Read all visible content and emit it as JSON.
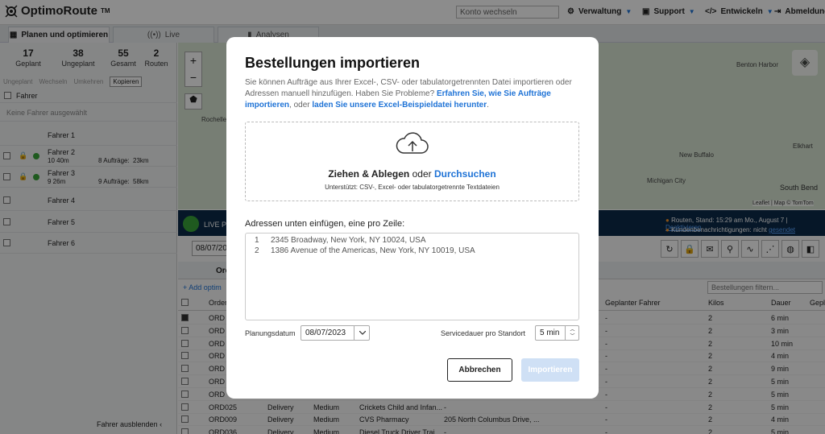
{
  "app": {
    "brand": "OptimoRoute",
    "brand_tm": "TM"
  },
  "topbar": {
    "account_switch_placeholder": "Konto wechseln",
    "nav": [
      "Verwaltung",
      "Support",
      "Entwickeln",
      "Abmeldung"
    ]
  },
  "tabs": [
    "Planen und optimieren",
    "Live",
    "Analysen"
  ],
  "stats": [
    {
      "value": "17",
      "label": "Geplant"
    },
    {
      "value": "38",
      "label": "Ungeplant"
    },
    {
      "value": "55",
      "label": "Gesamt"
    },
    {
      "value": "2",
      "label": "Routen"
    }
  ],
  "actions": {
    "unplan": "Ungeplant",
    "switch": "Wechseln",
    "redirect": "Umkehren",
    "copy": "Kopieren"
  },
  "drivers": {
    "header": "Fahrer",
    "none_selected": "Keine Fahrer ausgewählt",
    "list": [
      {
        "name": "Fahrer 1",
        "time": "",
        "orders": "",
        "dist": ""
      },
      {
        "name": "Fahrer 2",
        "time": "10 40m",
        "orders": "8 Aufträge:",
        "dist": "23km"
      },
      {
        "name": "Fahrer 3",
        "time": "9 26m",
        "orders": "9 Aufträge:",
        "dist": "58km"
      },
      {
        "name": "Fahrer 4",
        "time": "",
        "orders": "",
        "dist": ""
      },
      {
        "name": "Fahrer 5",
        "time": "",
        "orders": "",
        "dist": ""
      },
      {
        "name": "Fahrer 6",
        "time": "",
        "orders": "",
        "dist": ""
      }
    ],
    "hide": "Fahrer ausblenden"
  },
  "map": {
    "places": [
      "Benton Harbor",
      "Rochelle",
      "South Bend",
      "New Buffalo",
      "Michigan City",
      "Elkhart"
    ],
    "attribution": "Leaflet | Map © TomTom"
  },
  "livebar": {
    "label": "LIVE Pl",
    "routes_status": "Routen, Stand: 15:29 am Mo., August 7 |",
    "deactivate": "Deaktivieren",
    "notify": "Kundenbenachrichtigungen: nicht",
    "sent": "gesendet"
  },
  "orders": {
    "date": "08/07/20",
    "tab": "Ore",
    "add": "Add optim",
    "filter_placeholder": "Bestellungen filtern...",
    "columns": [
      "Order",
      "Geplanter Fahrer",
      "Kilos",
      "Dauer",
      "Gepl"
    ],
    "rows": [
      {
        "id": "ORD",
        "type": "",
        "prio": "",
        "name": "",
        "addr": "",
        "driver": "-",
        "kilos": "2",
        "dur": "6 min"
      },
      {
        "id": "ORD",
        "type": "",
        "prio": "",
        "name": "",
        "addr": "",
        "driver": "-",
        "kilos": "2",
        "dur": "3 min"
      },
      {
        "id": "ORD",
        "type": "",
        "prio": "",
        "name": "",
        "addr": "",
        "driver": "-",
        "kilos": "2",
        "dur": "10 min"
      },
      {
        "id": "ORD",
        "type": "",
        "prio": "",
        "name": "",
        "addr": "",
        "driver": "-",
        "kilos": "2",
        "dur": "4 min"
      },
      {
        "id": "ORD",
        "type": "",
        "prio": "",
        "name": "",
        "addr": "",
        "driver": "-",
        "kilos": "2",
        "dur": "9 min"
      },
      {
        "id": "ORD",
        "type": "",
        "prio": "",
        "name": "",
        "addr": "",
        "driver": "-",
        "kilos": "2",
        "dur": "5 min"
      },
      {
        "id": "ORD",
        "type": "",
        "prio": "",
        "name": "",
        "addr": "",
        "driver": "-",
        "kilos": "2",
        "dur": "5 min"
      },
      {
        "id": "ORD025",
        "type": "Delivery",
        "prio": "Medium",
        "name": "Crickets Child and Infan...",
        "addr": "-",
        "driver": "-",
        "kilos": "2",
        "dur": "5 min"
      },
      {
        "id": "ORD009",
        "type": "Delivery",
        "prio": "Medium",
        "name": "CVS Pharmacy",
        "addr": "205 North Columbus Drive, ...",
        "driver": "-",
        "kilos": "2",
        "dur": "4 min"
      },
      {
        "id": "ORD036",
        "type": "Delivery",
        "prio": "Medium",
        "name": "Diesel Truck Driver Trai...",
        "addr": "-",
        "driver": "-",
        "kilos": "2",
        "dur": "5 min"
      }
    ]
  },
  "modal": {
    "title": "Bestellungen importieren",
    "desc_part1": "Sie können Aufträge aus Ihrer Excel-, CSV- oder tabulatorgetrennten Datei importieren oder Adressen manuell hinzufügen. Haben Sie Probleme?",
    "desc_link1": "Erfahren Sie, wie Sie Aufträge importieren",
    "desc_part2": ", oder",
    "desc_link2": "laden Sie unsere Excel-Beispieldatei herunter",
    "desc_end": ".",
    "drop_main": "Ziehen & Ablegen",
    "drop_or": "oder",
    "drop_browse": "Durchsuchen",
    "drop_sub": "Unterstützt: CSV-, Excel- oder tabulatorgetrennte Textdateien",
    "paste_label": "Adressen unten einfügen, eine pro Zeile:",
    "addresses": [
      {
        "n": "1",
        "text": "2345 Broadway, New York, NY 10024, USA"
      },
      {
        "n": "2",
        "text": "1386 Avenue of the Americas, New York, NY 10019, USA"
      }
    ],
    "date_label": "Planungsdatum",
    "date_value": "08/07/2023",
    "service_label": "Servicedauer pro Standort",
    "service_value": "5 min",
    "cancel": "Abbrechen",
    "import": "Importieren"
  }
}
